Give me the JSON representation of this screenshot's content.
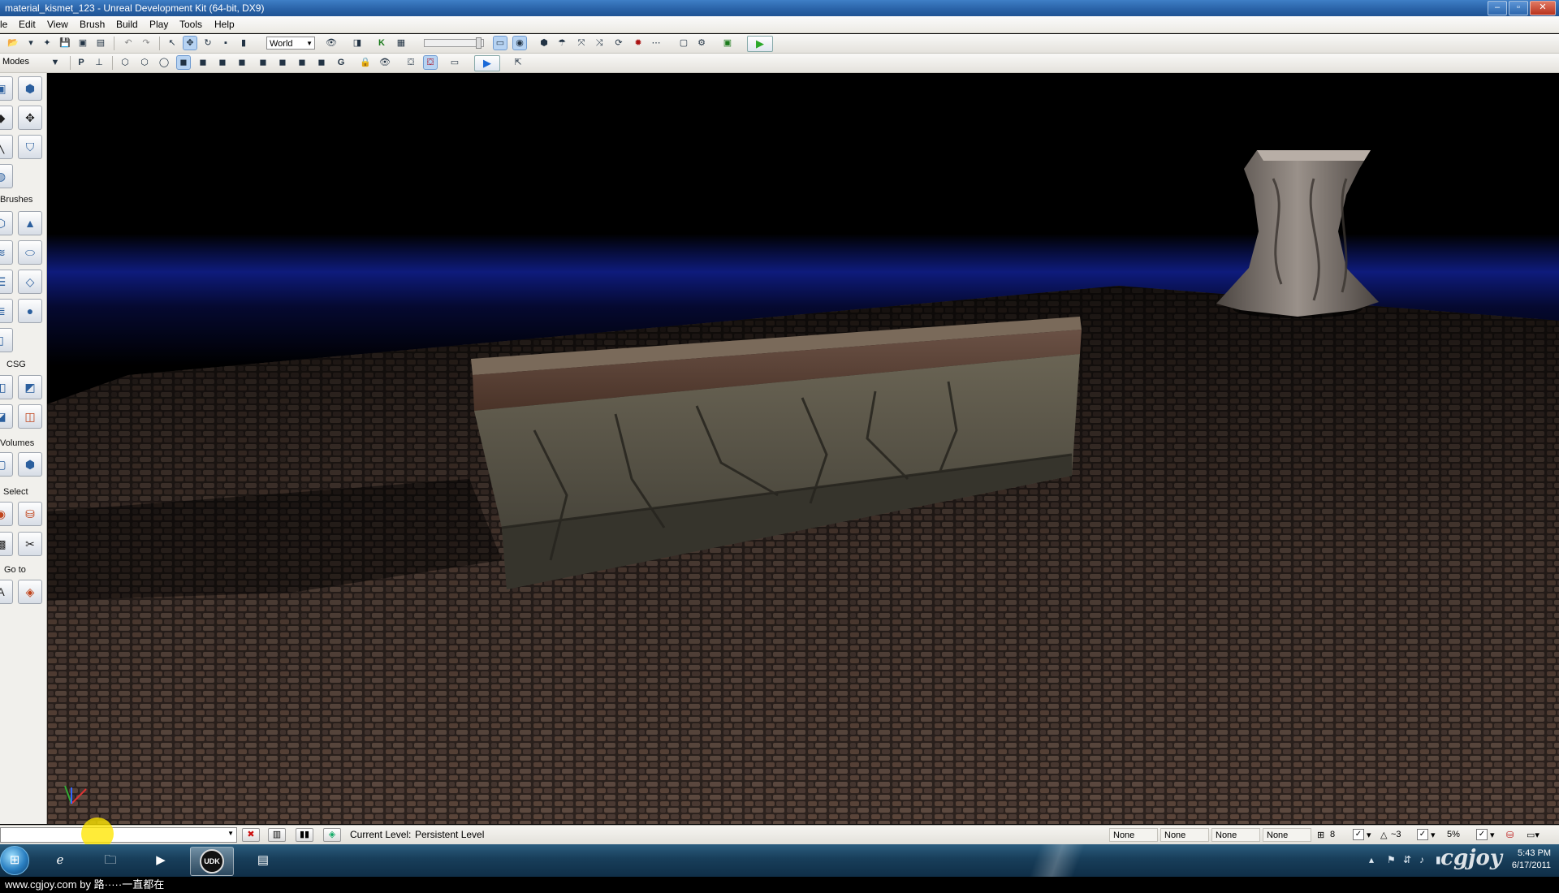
{
  "window": {
    "title": "material_kismet_123 - Unreal Development Kit (64-bit, DX9)",
    "buttons": [
      "–",
      "▫",
      "✕"
    ]
  },
  "menu": [
    "le",
    "Edit",
    "View",
    "Brush",
    "Build",
    "Play",
    "Tools",
    "Help"
  ],
  "toolbar": {
    "coord_system": "World",
    "modes_label": "Modes"
  },
  "side_panel": {
    "sections": {
      "brushes": "Brushes",
      "csg": "CSG",
      "volumes": "Volumes",
      "select": "Select",
      "goto": "Go to"
    }
  },
  "viewport": {
    "scene": "perspective view: stone wall on cobblestone floor with carved pedestal"
  },
  "status": {
    "current_level_label": "Current Level:",
    "current_level_value": "Persistent Level",
    "none_fields": [
      "None",
      "None",
      "None",
      "None"
    ],
    "grid_size": "8",
    "rotation_snap": "~3",
    "scale_snap": "5%"
  },
  "taskbar": {
    "clock_time": "5:43 PM",
    "clock_date": "6/17/2011",
    "apps": [
      "start-orb",
      "internet-explorer-icon",
      "folder-icon",
      "media-player-icon",
      "udk-icon",
      "notes-icon"
    ],
    "udk_label": "UDK",
    "watermark_logo": "cgjoy"
  },
  "footer": {
    "watermark": "www.cgjoy.com by 路·····一直都在"
  },
  "colors": {
    "title_bar": "#2a63a8",
    "viewport_bg": "#000000",
    "floor_brick": "#4a3830",
    "horizon_glow": "#1a2fb0",
    "cursor_highlight": "#ffe600"
  }
}
